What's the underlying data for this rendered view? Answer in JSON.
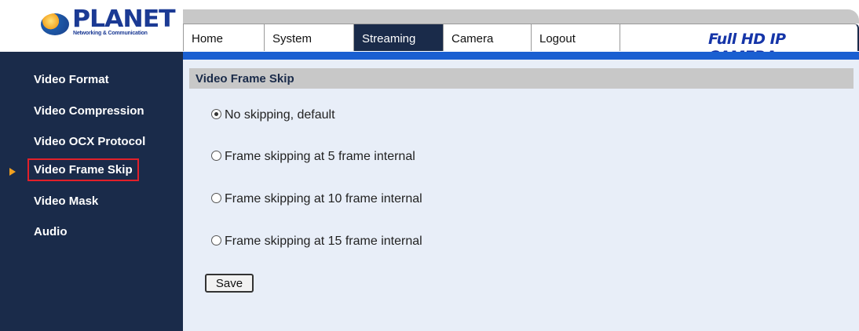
{
  "logo": {
    "brand": "PLANET",
    "tagline": "Networking & Communication"
  },
  "nav": {
    "tabs": [
      "Home",
      "System",
      "Streaming",
      "Camera",
      "Logout"
    ],
    "active": "Streaming",
    "product": "Full HD IP CAMERA"
  },
  "sidebar": {
    "items": [
      "Video Format",
      "Video Compression",
      "Video OCX Protocol",
      "Video Frame Skip",
      "Video Mask",
      "Audio"
    ],
    "selected": "Video Frame Skip"
  },
  "main": {
    "title": "Video Frame Skip",
    "options": [
      "No skipping, default",
      "Frame skipping at 5 frame internal",
      "Frame skipping at 10 frame internal",
      "Frame skipping at 15 frame internal"
    ],
    "selected_option": "No skipping, default",
    "save_label": "Save"
  },
  "colors": {
    "sidebar_bg": "#1a2b4a",
    "accent_blue": "#1a5fd1",
    "content_bg": "#e8eef8",
    "highlight_border": "#e2202a",
    "arrow": "#f0a020"
  }
}
